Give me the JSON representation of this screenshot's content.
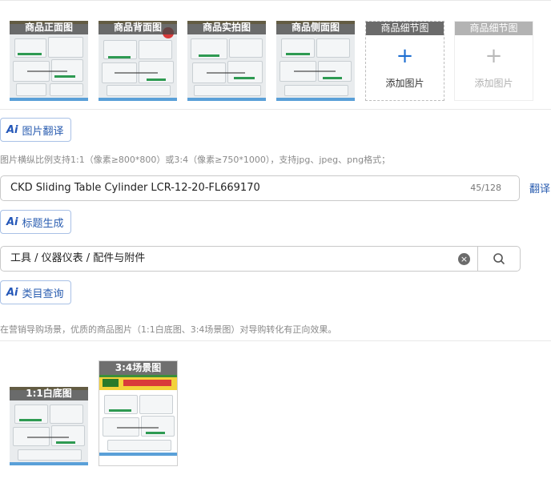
{
  "image_slots": [
    {
      "caption": "商品正面图"
    },
    {
      "caption": "商品背面图"
    },
    {
      "caption": "商品实拍图"
    },
    {
      "caption": "商品侧面图"
    }
  ],
  "add_slots": [
    {
      "caption": "商品细节图",
      "plus": "+",
      "label": "添加图片",
      "enabled": true
    },
    {
      "caption": "商品细节图",
      "plus": "+",
      "label": "添加图片",
      "enabled": false
    }
  ],
  "image_translate": {
    "ai": "Ai",
    "label": "图片翻译"
  },
  "image_hint": "图片横纵比例支持1:1（像素≥800*800）或3:4（像素≥750*1000），支持jpg、jpeg、png格式；",
  "title_field": {
    "value": "CKD Sliding Table Cylinder LCR-12-20-FL669170",
    "count": "45/128"
  },
  "translate_link": "翻译",
  "title_generate": {
    "ai": "Ai",
    "label": "标题生成"
  },
  "category_field": {
    "value": "工具 / 仪器仪表 / 配件与附件",
    "clear": "×"
  },
  "category_query": {
    "ai": "Ai",
    "label": "类目查询"
  },
  "marketing_hint": "在营销导购场景，优质的商品图片（1:1白底图、3:4场景图）对导购转化有正向效果。",
  "scene_images": [
    {
      "caption": "1:1白底图"
    },
    {
      "caption": "3:4场景图"
    }
  ],
  "colors": {
    "accent": "#2a5db0",
    "product_label_green": "#2e9a52",
    "banner_red": "#d93a3a",
    "banner_yellow": "#f3d23a"
  },
  "icons": [
    "plus-icon",
    "clear-icon",
    "search-icon",
    "ai-icon"
  ]
}
